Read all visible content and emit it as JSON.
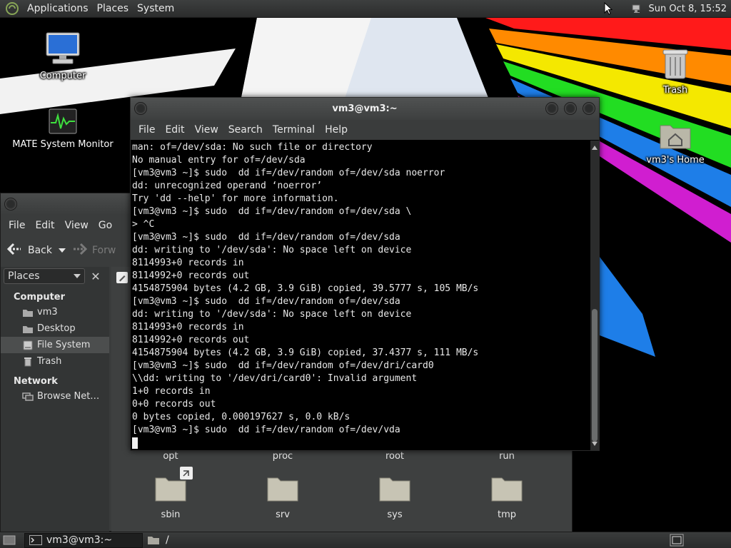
{
  "top_panel": {
    "menus": [
      "Applications",
      "Places",
      "System"
    ],
    "clock": "Sun Oct  8, 15:52"
  },
  "desktop": {
    "icons": [
      {
        "label": "Computer",
        "icon": "computer-icon"
      },
      {
        "label": "MATE System Monitor",
        "icon": "system-monitor-icon"
      },
      {
        "label": "Trash",
        "icon": "trash-icon"
      },
      {
        "label": "vm3's Home",
        "icon": "home-folder-icon"
      }
    ]
  },
  "file_manager": {
    "menus": [
      "File",
      "Edit",
      "View",
      "Go"
    ],
    "toolbar": {
      "back": "Back",
      "forward": "Forw"
    },
    "sidebar": {
      "selector": "Places",
      "sections": [
        {
          "title": "Computer",
          "items": [
            "vm3",
            "Desktop",
            "File System",
            "Trash"
          ]
        },
        {
          "title": "Network",
          "items": [
            "Browse Net…"
          ]
        }
      ]
    },
    "folders_top": [
      "opt",
      "proc",
      "root",
      "run"
    ],
    "folders_bottom": [
      "sbin",
      "srv",
      "sys",
      "tmp"
    ]
  },
  "terminal": {
    "title": "vm3@vm3:~",
    "menus": [
      "File",
      "Edit",
      "View",
      "Search",
      "Terminal",
      "Help"
    ],
    "lines": [
      "man: of=/dev/sda: No such file or directory",
      "No manual entry for of=/dev/sda",
      "[vm3@vm3 ~]$ sudo  dd if=/dev/random of=/dev/sda noerror",
      "dd: unrecognized operand ‘noerror’",
      "Try 'dd --help' for more information.",
      "[vm3@vm3 ~]$ sudo  dd if=/dev/random of=/dev/sda \\",
      "> ^C",
      "[vm3@vm3 ~]$ sudo  dd if=/dev/random of=/dev/sda",
      "dd: writing to '/dev/sda': No space left on device",
      "8114993+0 records in",
      "8114992+0 records out",
      "4154875904 bytes (4.2 GB, 3.9 GiB) copied, 39.5777 s, 105 MB/s",
      "[vm3@vm3 ~]$ sudo  dd if=/dev/random of=/dev/sda",
      "dd: writing to '/dev/sda': No space left on device",
      "8114993+0 records in",
      "8114992+0 records out",
      "4154875904 bytes (4.2 GB, 3.9 GiB) copied, 37.4377 s, 111 MB/s",
      "[vm3@vm3 ~]$ sudo  dd if=/dev/random of=/dev/dri/card0",
      "\\\\dd: writing to '/dev/dri/card0': Invalid argument",
      "1+0 records in",
      "0+0 records out",
      "0 bytes copied, 0.000197627 s, 0.0 kB/s",
      "[vm3@vm3 ~]$ sudo  dd if=/dev/random of=/dev/vda"
    ]
  },
  "bottom_panel": {
    "tasks": [
      "vm3@vm3:~",
      "/"
    ]
  }
}
